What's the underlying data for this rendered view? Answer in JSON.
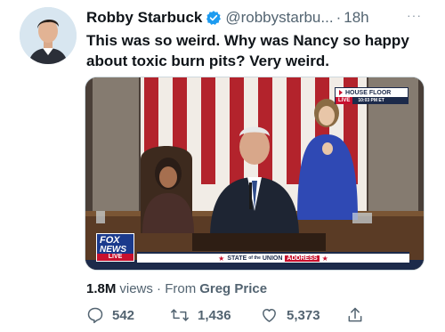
{
  "tweet": {
    "author_name": "Robby Starbuck",
    "handle": "@robbystarbu...",
    "separator": "·",
    "time": "18h",
    "more_label": "···",
    "text": "This was so weird. Why was Nancy so happy about toxic burn pits? Very weird.",
    "verified_icon": "verified-badge-icon",
    "accent_color": "#1d9bf0"
  },
  "media": {
    "description_icon": "video-still",
    "house_badge": {
      "title": "HOUSE FLOOR",
      "live": "LIVE",
      "time": "10:03 PM ET"
    },
    "logo": {
      "word1": "FOX",
      "word2": "NEWS",
      "live": "LIVE"
    },
    "banner": {
      "text": "STATE",
      "of": "of the",
      "union": "UNION",
      "address": "ADDRESS"
    }
  },
  "stats": {
    "views_count": "1.8M",
    "views_label": "views",
    "from_label": " · From",
    "source": "Greg Price"
  },
  "actions": {
    "replies": "542",
    "retweets": "1,436",
    "likes": "5,373"
  }
}
